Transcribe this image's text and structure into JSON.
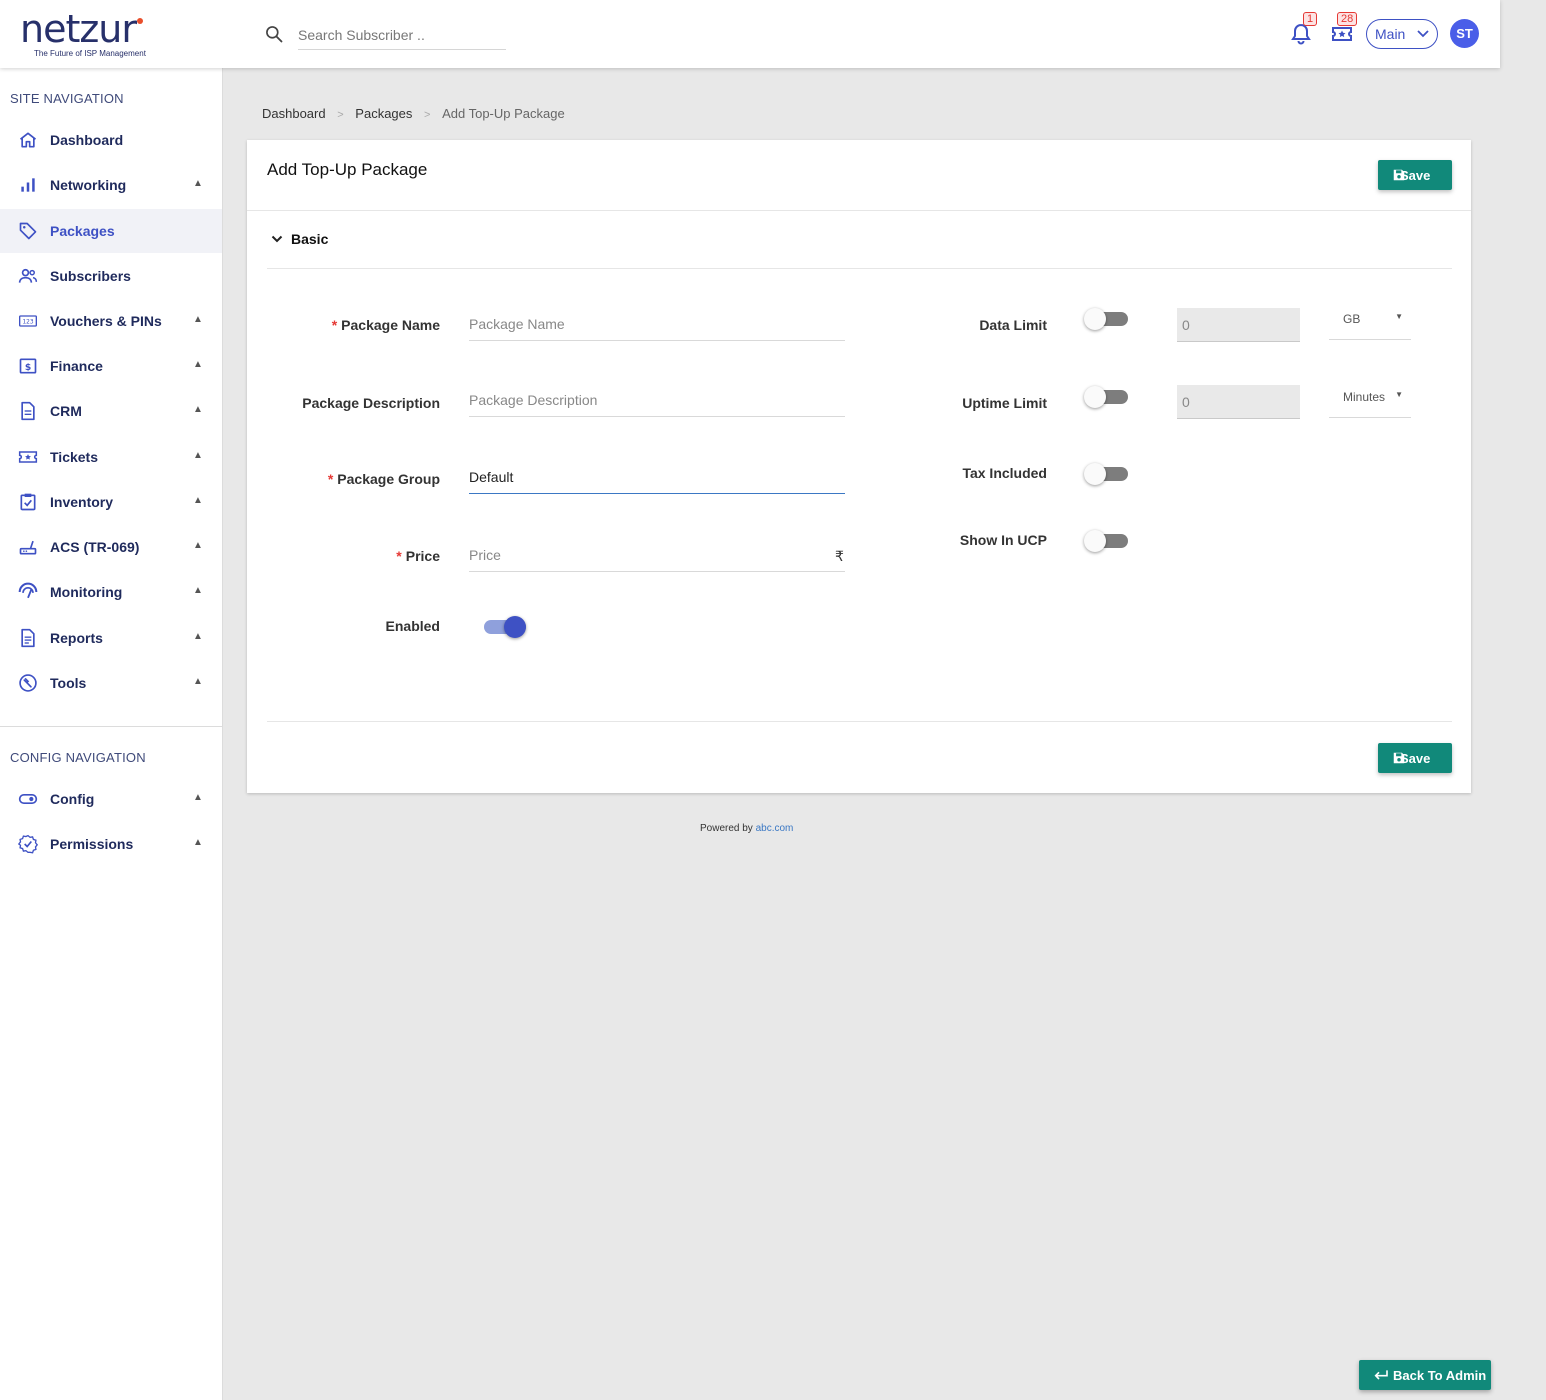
{
  "header": {
    "logo_text": "netzur",
    "logo_tagline": "The Future of ISP Management",
    "search_placeholder": "Search Subscriber ..",
    "notifications_count": "1",
    "tickets_count": "28",
    "branch_select": "Main",
    "avatar_initials": "ST"
  },
  "sidebar": {
    "site_heading": "SITE NAVIGATION",
    "items": [
      {
        "label": "Dashboard",
        "icon": "home-icon",
        "has_caret": false
      },
      {
        "label": "Networking",
        "icon": "bar-chart-icon",
        "has_caret": true
      },
      {
        "label": "Packages",
        "icon": "tag-icon",
        "has_caret": false,
        "active": true
      },
      {
        "label": "Subscribers",
        "icon": "users-icon",
        "has_caret": false
      },
      {
        "label": "Vouchers & PINs",
        "icon": "pin-123-icon",
        "has_caret": true
      },
      {
        "label": "Finance",
        "icon": "dollar-icon",
        "has_caret": true
      },
      {
        "label": "CRM",
        "icon": "document-icon",
        "has_caret": true
      },
      {
        "label": "Tickets",
        "icon": "ticket-icon",
        "has_caret": true
      },
      {
        "label": "Inventory",
        "icon": "clipboard-check-icon",
        "has_caret": true
      },
      {
        "label": "ACS (TR-069)",
        "icon": "router-icon",
        "has_caret": true
      },
      {
        "label": "Monitoring",
        "icon": "gauge-icon",
        "has_caret": true
      },
      {
        "label": "Reports",
        "icon": "report-icon",
        "has_caret": true
      },
      {
        "label": "Tools",
        "icon": "wrench-icon",
        "has_caret": true
      }
    ],
    "config_heading": "CONFIG NAVIGATION",
    "config_items": [
      {
        "label": "Config",
        "icon": "toggle-icon",
        "has_caret": true
      },
      {
        "label": "Permissions",
        "icon": "badge-check-icon",
        "has_caret": true
      }
    ],
    "caret_glyph": "▲"
  },
  "breadcrumb": {
    "items": [
      "Dashboard",
      "Packages"
    ],
    "current": "Add Top-Up Package",
    "separator": ">"
  },
  "form": {
    "title": "Add Top-Up Package",
    "save_label": "Save",
    "section_label": "Basic",
    "fields": {
      "package_name": {
        "label": "Package Name",
        "placeholder": "Package Name",
        "required": "*"
      },
      "package_description": {
        "label": "Package Description",
        "placeholder": "Package Description"
      },
      "package_group": {
        "label": "Package Group",
        "value": "Default",
        "required": "*"
      },
      "price": {
        "label": "Price",
        "placeholder": "Price",
        "required": "*",
        "currency": "₹"
      },
      "enabled": {
        "label": "Enabled",
        "on": true
      }
    },
    "right_fields": {
      "data_limit": {
        "label": "Data Limit",
        "on": false,
        "value": "0",
        "unit": "GB"
      },
      "uptime_limit": {
        "label": "Uptime Limit",
        "on": false,
        "value": "0",
        "unit": "Minutes"
      },
      "tax_included": {
        "label": "Tax Included",
        "on": false
      },
      "show_in_ucp": {
        "label": "Show In UCP",
        "on": false
      }
    }
  },
  "footer": {
    "powered_by": "Powered by",
    "powered_link": "abc.com"
  },
  "back_button": "Back To Admin",
  "colors": {
    "accent": "#3e51c4",
    "save_button": "#11897a",
    "brand_navy": "#27306a",
    "badge_red": "#e53935"
  }
}
